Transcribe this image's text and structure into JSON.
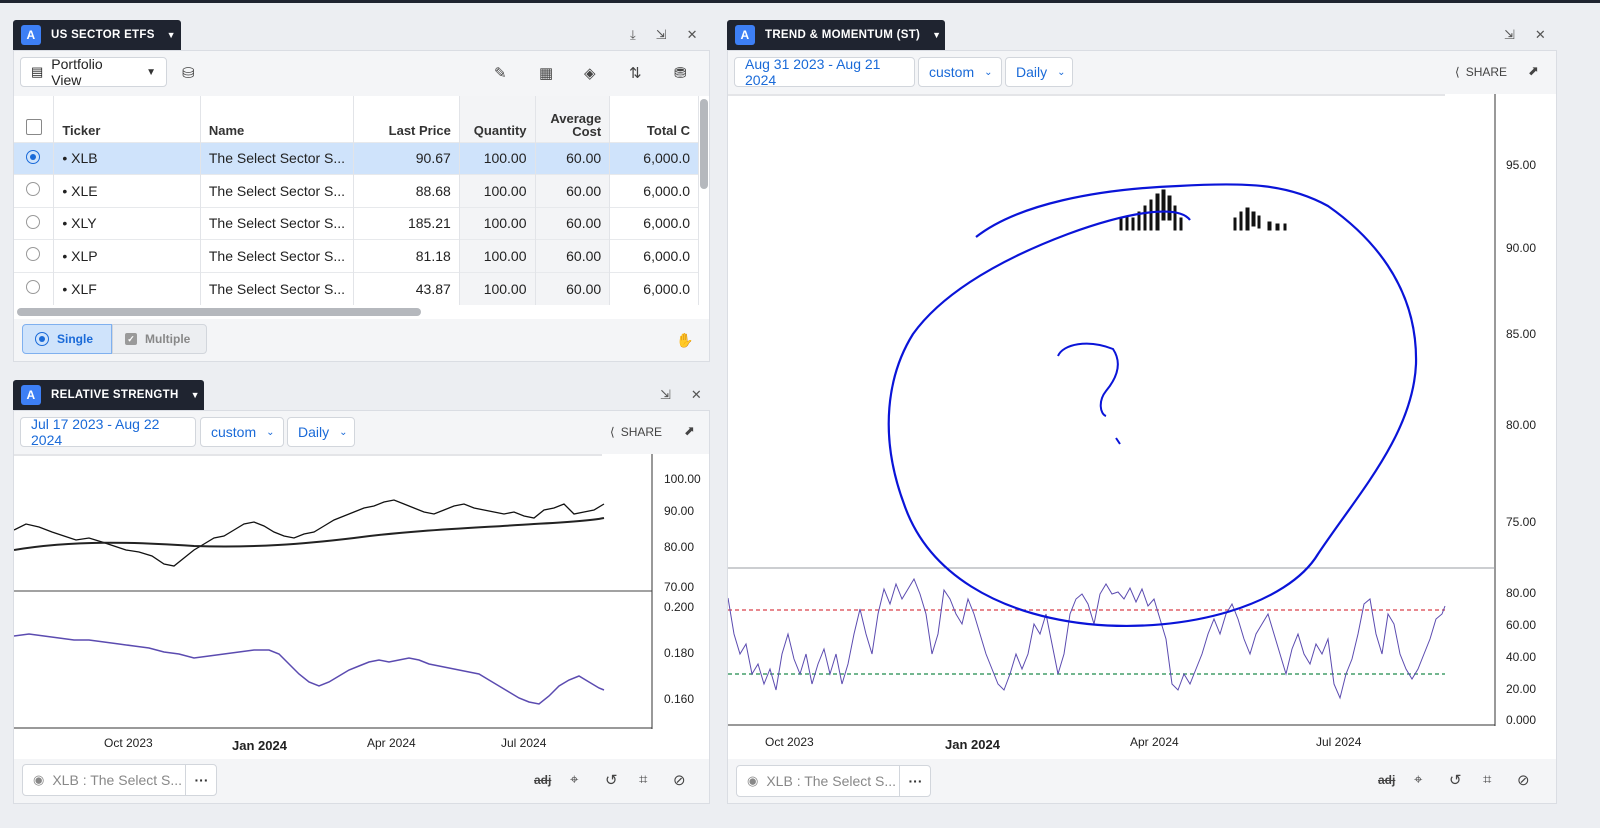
{
  "etf_panel": {
    "title": "US SECTOR ETFS",
    "badge": "A",
    "view_label": "Portfolio View",
    "columns": [
      "Ticker",
      "Name",
      "Last Price",
      "Quantity",
      "Average Cost",
      "Total C"
    ],
    "rows": [
      {
        "ticker": "• XLB",
        "name": "The Select Sector S...",
        "last": "90.67",
        "qty": "100.00",
        "avg": "60.00",
        "total": "6,000.0"
      },
      {
        "ticker": "• XLE",
        "name": "The Select Sector S...",
        "last": "88.68",
        "qty": "100.00",
        "avg": "60.00",
        "total": "6,000.0"
      },
      {
        "ticker": "• XLY",
        "name": "The Select Sector S...",
        "last": "185.21",
        "qty": "100.00",
        "avg": "60.00",
        "total": "6,000.0"
      },
      {
        "ticker": "• XLP",
        "name": "The Select Sector S...",
        "last": "81.18",
        "qty": "100.00",
        "avg": "60.00",
        "total": "6,000.0"
      },
      {
        "ticker": "• XLF",
        "name": "The Select Sector S...",
        "last": "43.87",
        "qty": "100.00",
        "avg": "60.00",
        "total": "6,000.0"
      }
    ],
    "single_label": "Single",
    "multiple_label": "Multiple"
  },
  "rs_panel": {
    "title": "RELATIVE STRENGTH",
    "badge": "A",
    "date_range": "Jul 17 2023 - Aug 22 2024",
    "range_mode": "custom",
    "interval": "Daily",
    "share_label": "SHARE",
    "upper_ticks": [
      "100.00",
      "90.00",
      "80.00",
      "70.00"
    ],
    "lower_ticks": [
      "0.200",
      "0.180",
      "0.160"
    ],
    "x_ticks": [
      "Oct 2023",
      "Jan 2024",
      "Apr 2024",
      "Jul 2024"
    ],
    "symbol_label": "XLB : The Select S...",
    "more_label": "···",
    "adj_label": "adj"
  },
  "tm_panel": {
    "title": "TREND & MOMENTUM (ST)",
    "badge": "A",
    "date_range": "Aug 31 2023 - Aug 21 2024",
    "range_mode": "custom",
    "interval": "Daily",
    "share_label": "SHARE",
    "upper_ticks": [
      "95.00",
      "90.00",
      "85.00",
      "80.00",
      "75.00"
    ],
    "lower_ticks": [
      "80.00",
      "60.00",
      "40.00",
      "20.00",
      "0.000"
    ],
    "x_ticks": [
      "Oct 2023",
      "Jan 2024",
      "Apr 2024",
      "Jul 2024"
    ],
    "symbol_label": "XLB : The Select S...",
    "more_label": "···",
    "adj_label": "adj"
  },
  "colors": {
    "accent": "#1a6ad8",
    "tab_bg": "#1f2430",
    "badge": "#3d7ff5",
    "annotation": "#0a14d8",
    "rsi_line": "#5b4bb0",
    "overbought": "#d9404a",
    "oversold": "#1f8a4c"
  }
}
